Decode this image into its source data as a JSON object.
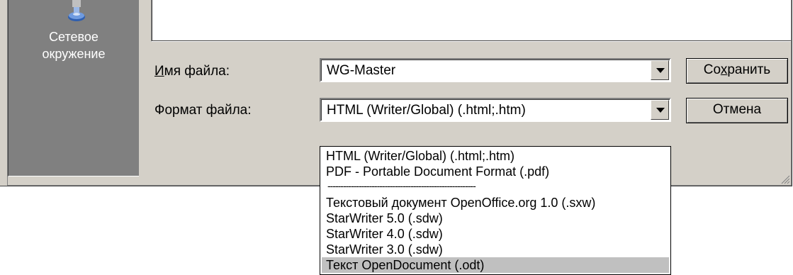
{
  "places": [
    {
      "label": "Сетевое\nокружение",
      "icon": "network-places-icon"
    }
  ],
  "form": {
    "filename_label_prefix": "И",
    "filename_label_rest": "мя файла:",
    "filename_value": "WG-Master",
    "format_label": "Формат файла:",
    "format_value": "HTML (Writer/Global) (.html;.htm)"
  },
  "buttons": {
    "save_prefix": "Со",
    "save_underline": "х",
    "save_suffix": "ранить",
    "cancel": "Отмена"
  },
  "dropdown": {
    "items": [
      "HTML (Writer/Global) (.html;.htm)",
      "PDF - Portable Document Format (.pdf)",
      "---------------------------------------------------------",
      "Текстовый документ OpenOffice.org 1.0 (.sxw)",
      "StarWriter 5.0 (.sdw)",
      "StarWriter 4.0 (.sdw)",
      "StarWriter 3.0 (.sdw)",
      "Текст OpenDocument (.odt)"
    ],
    "selected_index": 7
  },
  "colors": {
    "dialog_bg": "#d4d0c8",
    "places_bg": "#808080",
    "selected_bg": "#c0c0c0"
  }
}
